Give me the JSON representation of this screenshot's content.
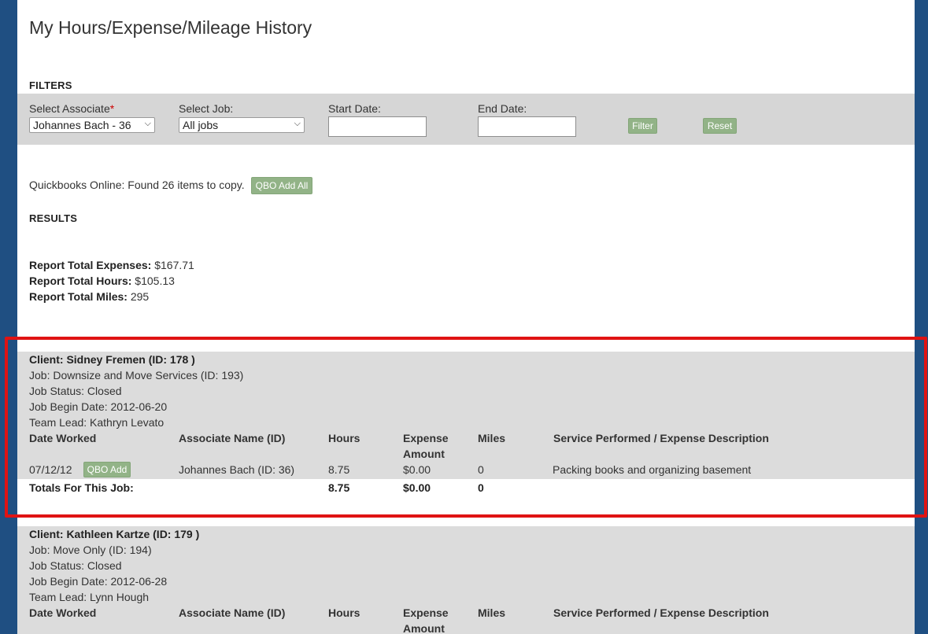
{
  "page": {
    "title": "My Hours/Expense/Mileage History"
  },
  "filters": {
    "heading": "FILTERS",
    "associate_label": "Select Associate",
    "associate_required_mark": "*",
    "associate_value": "Johannes Bach - 36",
    "job_label": "Select Job:",
    "job_value": "All jobs",
    "start_date_label": "Start Date:",
    "end_date_label": "End Date:",
    "filter_button": "Filter",
    "reset_button": "Reset"
  },
  "qbo": {
    "message": "Quickbooks Online: Found 26 items to copy.",
    "add_all_button": "QBO Add All"
  },
  "results": {
    "heading": "RESULTS",
    "expenses_label": "Report Total Expenses:",
    "expenses_value": "$167.71",
    "hours_label": "Report Total Hours:",
    "hours_value": "$105.13",
    "miles_label": "Report Total Miles:",
    "miles_value": "295"
  },
  "columns": {
    "date": "Date Worked",
    "associate": "Associate Name (ID)",
    "hours": "Hours",
    "expense_line1": "Expense",
    "expense_line2": "Amount",
    "miles": "Miles",
    "service": "Service Performed / Expense Description"
  },
  "jobs": [
    {
      "client": "Client: Sidney Fremen (ID: 178 )",
      "job": "Job: Downsize and Move Services (ID: 193)",
      "status": "Job Status: Closed",
      "begin": "Job Begin Date: 2012-06-20",
      "lead": "Team Lead: Kathryn Levato",
      "row": {
        "date": "07/12/12",
        "qbo_button": "QBO Add",
        "associate": "Johannes Bach (ID: 36)",
        "hours": "8.75",
        "expense": "$0.00",
        "miles": "0",
        "service": "Packing books and organizing basement"
      },
      "totals": {
        "label": "Totals For This Job:",
        "hours": "8.75",
        "expense": "$0.00",
        "miles": "0"
      }
    },
    {
      "client": "Client: Kathleen Kartze (ID: 179 )",
      "job": "Job: Move Only (ID: 194)",
      "status": "Job Status: Closed",
      "begin": "Job Begin Date: 2012-06-28",
      "lead": "Team Lead: Lynn Hough"
    }
  ]
}
